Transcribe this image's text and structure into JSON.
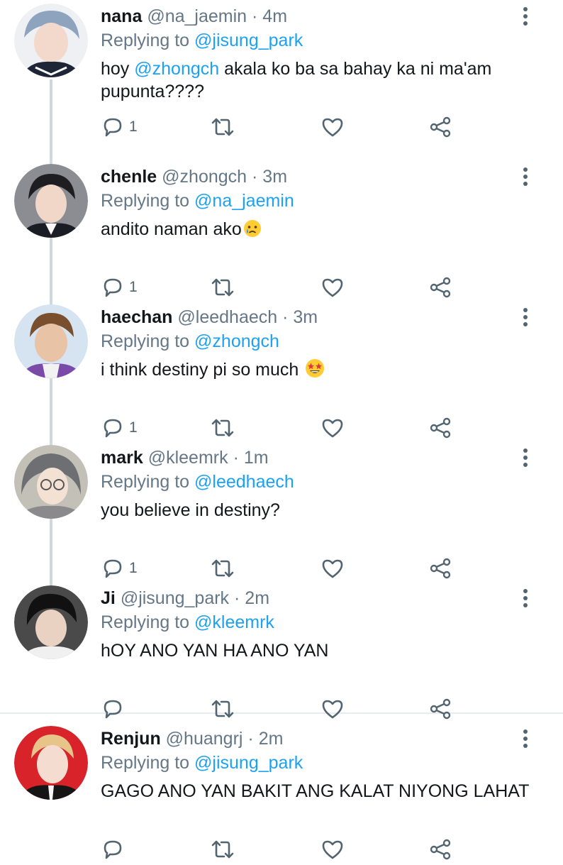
{
  "colors": {
    "accent": "#1da1f2",
    "muted": "#657786",
    "text": "#14171a",
    "thread_line": "#cfd9de"
  },
  "tweets": [
    {
      "name": "nana",
      "handle": "@na_jaemin",
      "time": "4m",
      "reply_prefix": "Replying to",
      "reply_to": "@jisung_park",
      "body_pre": "hoy ",
      "body_mention": "@zhongch",
      "body_post": " akala ko ba sa bahay ka ni ma'am pupunta????",
      "emoji": "",
      "reply_count": "1",
      "avatar_color": "#a9b9cc"
    },
    {
      "name": "chenle",
      "handle": "@zhongch",
      "time": "3m",
      "reply_prefix": "Replying to",
      "reply_to": "@na_jaemin",
      "body_pre": "andito naman ako",
      "body_mention": "",
      "body_post": "",
      "emoji": "crying-face",
      "reply_count": "1",
      "avatar_color": "#2b2b33"
    },
    {
      "name": "haechan",
      "handle": "@leedhaech",
      "time": "3m",
      "reply_prefix": "Replying to",
      "reply_to": "@zhongch",
      "body_pre": "i think destiny pi so much ",
      "body_mention": "",
      "body_post": "",
      "emoji": "star-struck",
      "reply_count": "1",
      "avatar_color": "#d9e4f0"
    },
    {
      "name": "mark",
      "handle": "@kleemrk",
      "time": "1m",
      "reply_prefix": "Replying to",
      "reply_to": "@leedhaech",
      "body_pre": "you believe in destiny?",
      "body_mention": "",
      "body_post": "",
      "emoji": "",
      "reply_count": "1",
      "avatar_color": "#c9c6c0"
    },
    {
      "name": "Ji",
      "handle": "@jisung_park",
      "time": "2m",
      "reply_prefix": "Replying to",
      "reply_to": "@kleemrk",
      "body_pre": "hOY ANO YAN HA ANO YAN",
      "body_mention": "",
      "body_post": "",
      "emoji": "",
      "reply_count": "",
      "avatar_color": "#3a3a3a"
    },
    {
      "name": "Renjun",
      "handle": "@huangrj",
      "time": "2m",
      "reply_prefix": "Replying to",
      "reply_to": "@jisung_park",
      "body_pre": "GAGO ANO YAN BAKIT ANG KALAT NIYONG LAHAT",
      "body_mention": "",
      "body_post": "",
      "emoji": "",
      "reply_count": "",
      "avatar_color": "#d8232a"
    }
  ],
  "icons": {
    "reply": "reply-icon",
    "retweet": "retweet-icon",
    "like": "heart-icon",
    "share": "share-icon",
    "more": "more-options-icon"
  },
  "dot": "·"
}
